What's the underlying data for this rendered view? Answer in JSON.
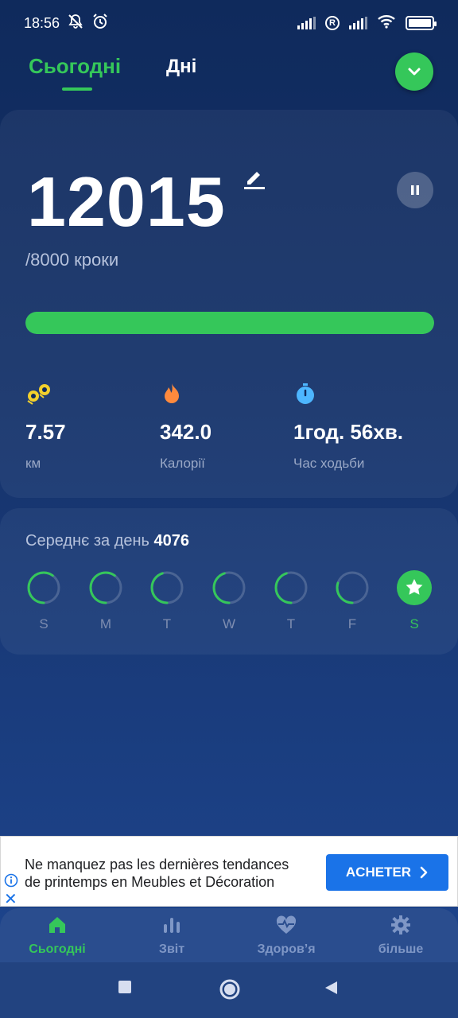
{
  "status_bar": {
    "time": "18:56",
    "icons": [
      "bell-off-icon",
      "alarm-icon",
      "signal-icon",
      "r-badge-icon",
      "signal-icon",
      "wifi-icon",
      "battery-icon"
    ],
    "r_badge": "R"
  },
  "tabs": {
    "today": "Сьогодні",
    "days": "Дні"
  },
  "main": {
    "steps": "12015",
    "goal_text": "/8000 кроки",
    "progress": 1.0,
    "accent_color": "#35c75a",
    "stats": [
      {
        "icon": "distance-icon",
        "value": "7.57",
        "label": "км",
        "color": "#f2d02c"
      },
      {
        "icon": "fire-icon",
        "value": "342.0",
        "label": "Калорії",
        "color": "#ff8a3d"
      },
      {
        "icon": "stopwatch-icon",
        "value": "1год. 56хв.",
        "label": "Час ходьби",
        "color": "#4db6ff"
      }
    ]
  },
  "week": {
    "avg_label": "Середнє за день",
    "avg_value": "4076",
    "days": [
      {
        "letter": "S",
        "progress": 0.6,
        "goal_reached": false
      },
      {
        "letter": "M",
        "progress": 0.6,
        "goal_reached": false
      },
      {
        "letter": "T",
        "progress": 0.45,
        "goal_reached": false
      },
      {
        "letter": "W",
        "progress": 0.45,
        "goal_reached": false
      },
      {
        "letter": "T",
        "progress": 0.45,
        "goal_reached": false
      },
      {
        "letter": "F",
        "progress": 0.3,
        "goal_reached": false
      },
      {
        "letter": "S",
        "progress": 1.0,
        "goal_reached": true
      }
    ]
  },
  "ad": {
    "line1": "Ne manquez pas les dernières tendances",
    "line2": "de printemps en Meubles et Décoration",
    "cta": "ACHETER",
    "close": "✕"
  },
  "bottom_nav": [
    {
      "label": "Сьогодні",
      "icon": "home-icon",
      "active": true
    },
    {
      "label": "Звіт",
      "icon": "bar-chart-icon",
      "active": false
    },
    {
      "label": "Здоров’я",
      "icon": "heart-pulse-icon",
      "active": false
    },
    {
      "label": "більше",
      "icon": "gear-icon",
      "active": false
    }
  ]
}
